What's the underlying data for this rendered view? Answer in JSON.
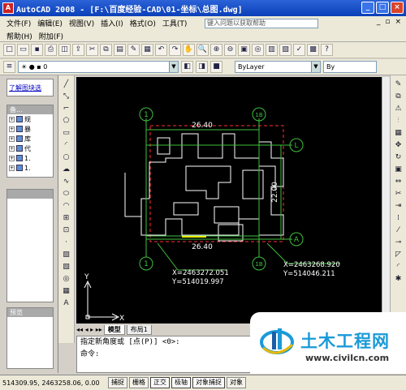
{
  "window": {
    "title": "AutoCAD 2008 - [F:\\百度经验-CAD\\01-坐标\\总图.dwg]",
    "icon": "autocad-icon"
  },
  "menu": {
    "row1": [
      "文件(F)",
      "编辑(E)",
      "视图(V)",
      "插入(I)",
      "格式(O)",
      "工具(T)"
    ],
    "row2": [
      "帮助(H)",
      "附加(F)"
    ],
    "search_placeholder": "键入问题以获取帮助"
  },
  "layers": {
    "current_layer": "0",
    "linetype": "ByLayer",
    "lineweight": "By"
  },
  "palettes": {
    "top_link": "了解图块选",
    "blocks_header": "备...",
    "tree_items": [
      "规",
      "暴",
      "库",
      "代",
      "1.",
      "1."
    ],
    "preview_label": "预览"
  },
  "drawing": {
    "dim_top": "26.40",
    "dim_mid": "26.40",
    "dim_side": "22.00",
    "grid_left": "1",
    "grid_right": "1B",
    "grid_top": "L",
    "grid_bottom": "A",
    "coord_left_x": "X=2463272.051",
    "coord_left_y": "Y=514019.997",
    "coord_right_x": "X=2463268.920",
    "coord_right_y": "Y=514046.211",
    "axis_x": "X",
    "axis_y": "Y"
  },
  "tabs": [
    "模型",
    "布局1"
  ],
  "command": {
    "line1": "指定新角度或 [点(P)] <0>:",
    "line2": "命令:"
  },
  "status": {
    "coords": "514309.95, 2463258.06, 0.00",
    "buttons": [
      "捕捉",
      "栅格",
      "正交",
      "极轴",
      "对象捕捉",
      "对象"
    ]
  },
  "watermark": {
    "title": "土木工程网",
    "url": "www.civilcn.com"
  }
}
